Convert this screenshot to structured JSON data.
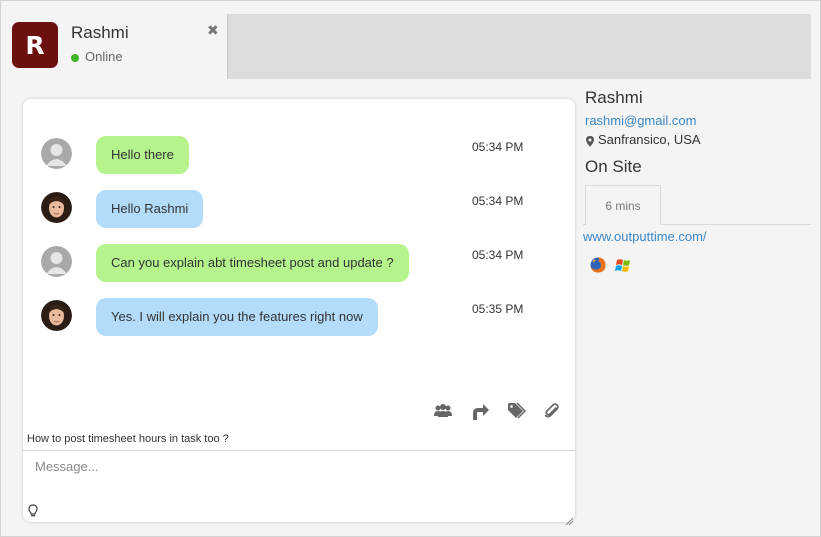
{
  "contact": {
    "initial": "R",
    "name": "Rashmi",
    "status": "Online",
    "status_color": "#3cb521",
    "avatar_color": "#6b0f0f"
  },
  "messages": [
    {
      "text": "Hello there",
      "time": "05:34 PM",
      "sender": "visitor",
      "bubble_color": "#b5f48c"
    },
    {
      "text": "Hello Rashmi",
      "time": "05:34 PM",
      "sender": "agent",
      "bubble_color": "#b3dcfb"
    },
    {
      "text": "Can you explain abt timesheet post and update ?",
      "time": "05:34 PM",
      "sender": "visitor",
      "bubble_color": "#b5f48c"
    },
    {
      "text": "Yes. I will explain you the features right now",
      "time": "05:35 PM",
      "sender": "agent",
      "bubble_color": "#b3dcfb"
    }
  ],
  "toolbar": {
    "icons": [
      "users-icon",
      "share-arrow-icon",
      "tags-icon",
      "paperclip-icon"
    ]
  },
  "suggestion": "How to post timesheet hours in task too ?",
  "composer": {
    "placeholder": "Message..."
  },
  "info": {
    "name": "Rashmi",
    "email": "rashmi@gmail.com",
    "location": "Sanfransico, USA",
    "site_status": "On Site",
    "duration": "6 mins",
    "url": "www.outputtime.com/",
    "browser_icon": "firefox-icon",
    "os_icon": "windows-icon"
  }
}
